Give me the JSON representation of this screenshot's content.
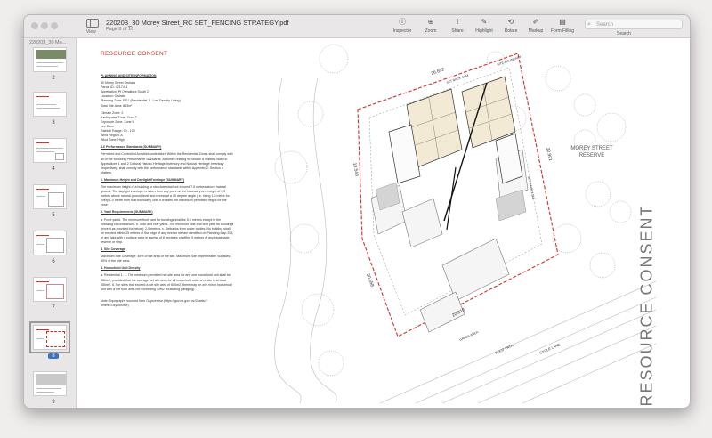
{
  "window": {
    "title": "220203_30 Morey Street_RC SET_FENCING STRATEGY.pdf",
    "subtitle": "Page 8 of 16"
  },
  "toolbar": {
    "view_label": "View",
    "items": [
      {
        "label": "Inspector",
        "icon": "info-icon"
      },
      {
        "label": "Zoom",
        "icon": "zoom-icon"
      },
      {
        "label": "Share",
        "icon": "share-icon"
      },
      {
        "label": "Highlight",
        "icon": "highlight-icon"
      },
      {
        "label": "Rotate",
        "icon": "rotate-icon"
      },
      {
        "label": "Markup",
        "icon": "markup-icon"
      },
      {
        "label": "Form Filling",
        "icon": "form-filling-icon"
      }
    ],
    "search_placeholder": "Search",
    "search_label": "Search"
  },
  "sidebar": {
    "header": "220203_30 Mo...",
    "pages": [
      "2",
      "3",
      "4",
      "5",
      "6",
      "7",
      "8",
      "9"
    ],
    "selected": "8"
  },
  "document": {
    "heading": "RESOURCE CONSENT",
    "planning_heading": "PLANNING AND SITE INFORMATION",
    "site_info": [
      "30 Morey Street Owhata",
      "Parcel ID: 4217411",
      "Appellation: Pt Owhatiura South 2",
      "Location: Owhata",
      "Planning Zone: RD1 (Residential 1 - Low Density Living)",
      "Total Site Area: 853m²"
    ],
    "climate": [
      "Climate Zone: 2",
      "Earthquake Zone: Zone 2",
      "Exposure Zone: Zone B",
      "Lee Zone",
      "Rainfall Range: 90 - 100",
      "Wind Region: A",
      "Wind Zone: High"
    ],
    "performance_heading": "4.6 Performance Standards (SUMMARY)",
    "performance_text": "Permitted and Controlled Activities undertaken Within the Residential Zones shall comply with all of the following Performance Standards. Activities relating to Section 8 matters listed in Appendices 1 and 2 Cultural Historic Heritage Inventory and Natural Heritage Inventory respectively, shall comply with the performance standards within Appendix 2: Section 6 Matters.",
    "s1_heading": "1. Maximum Height and Daylight Envelope (SUMMARY)",
    "s1_text": "The maximum height of a building or structure shall not exceed 7.5 metres above natural ground. The daylight envelope is taken from any point on the boundary at a height of 3.0 metres above natural ground level and recess at a 45 degree angle (i.e. rising 1.0 metre for every 1.0 metre from that boundary) until it crosses the maximum permitted height for the zone.",
    "s2_heading": "2. Yard Requirements (SUMMARY)",
    "s2_text": "a. Front yards. The minimum front yard for buildings shall be 5.0 metres except in the following circumstances. b. Side and rear yards. The minimum side and rear yard for buildings (except as provided for below): 2.0 metres. c. Setbacks from water bodies. No building shall be erected within 25 metres of the edge of any river or stream identified on Planning Map 203, or any lake with a surface area in excess of 8 hectares or within 5 metres of any esplanade reserve or strip.",
    "s3_heading": "3. Site Coverage",
    "s3_text": "Maximum Site Coverage: 45% of the area of the site. Maximum Site Impermeable Surfaces: 65% of the site area.",
    "s4_heading": "4. Household Unit Density",
    "s4_text": "a. Residential 1. 1. The minimum permitted net site area for any one household unit shall be 350m2, provided that the average net site area for all household units on a site is at least 450m2. 6. For sites that exceed a net site area of 650m2, there may be one minor household unit with a net floor area not exceeding 70m2 (excluding garaging).",
    "note": "Note: Topography sourced from Ozyconvise (https://gov.nz.govt.nz/2parts/?where=Ozyconvise)",
    "reserve_label": "MOREY STREET RESERVE",
    "vertical_label": "RESOURCE CONSENT",
    "plan_labels": {
      "north_dim": "26.692",
      "east_dim": "32.991",
      "west_dim": "18.548",
      "sw_dim": "20.558",
      "south_dim": "20.818",
      "setback_3": "SET BACK 3.0M",
      "setback_15": "SET BACK 1.5M",
      "boundary": "SITE BOUNDARY",
      "street": "CYCLE LANE",
      "footpath": "FOOT PATH",
      "grass": "GRASS AREA"
    }
  }
}
